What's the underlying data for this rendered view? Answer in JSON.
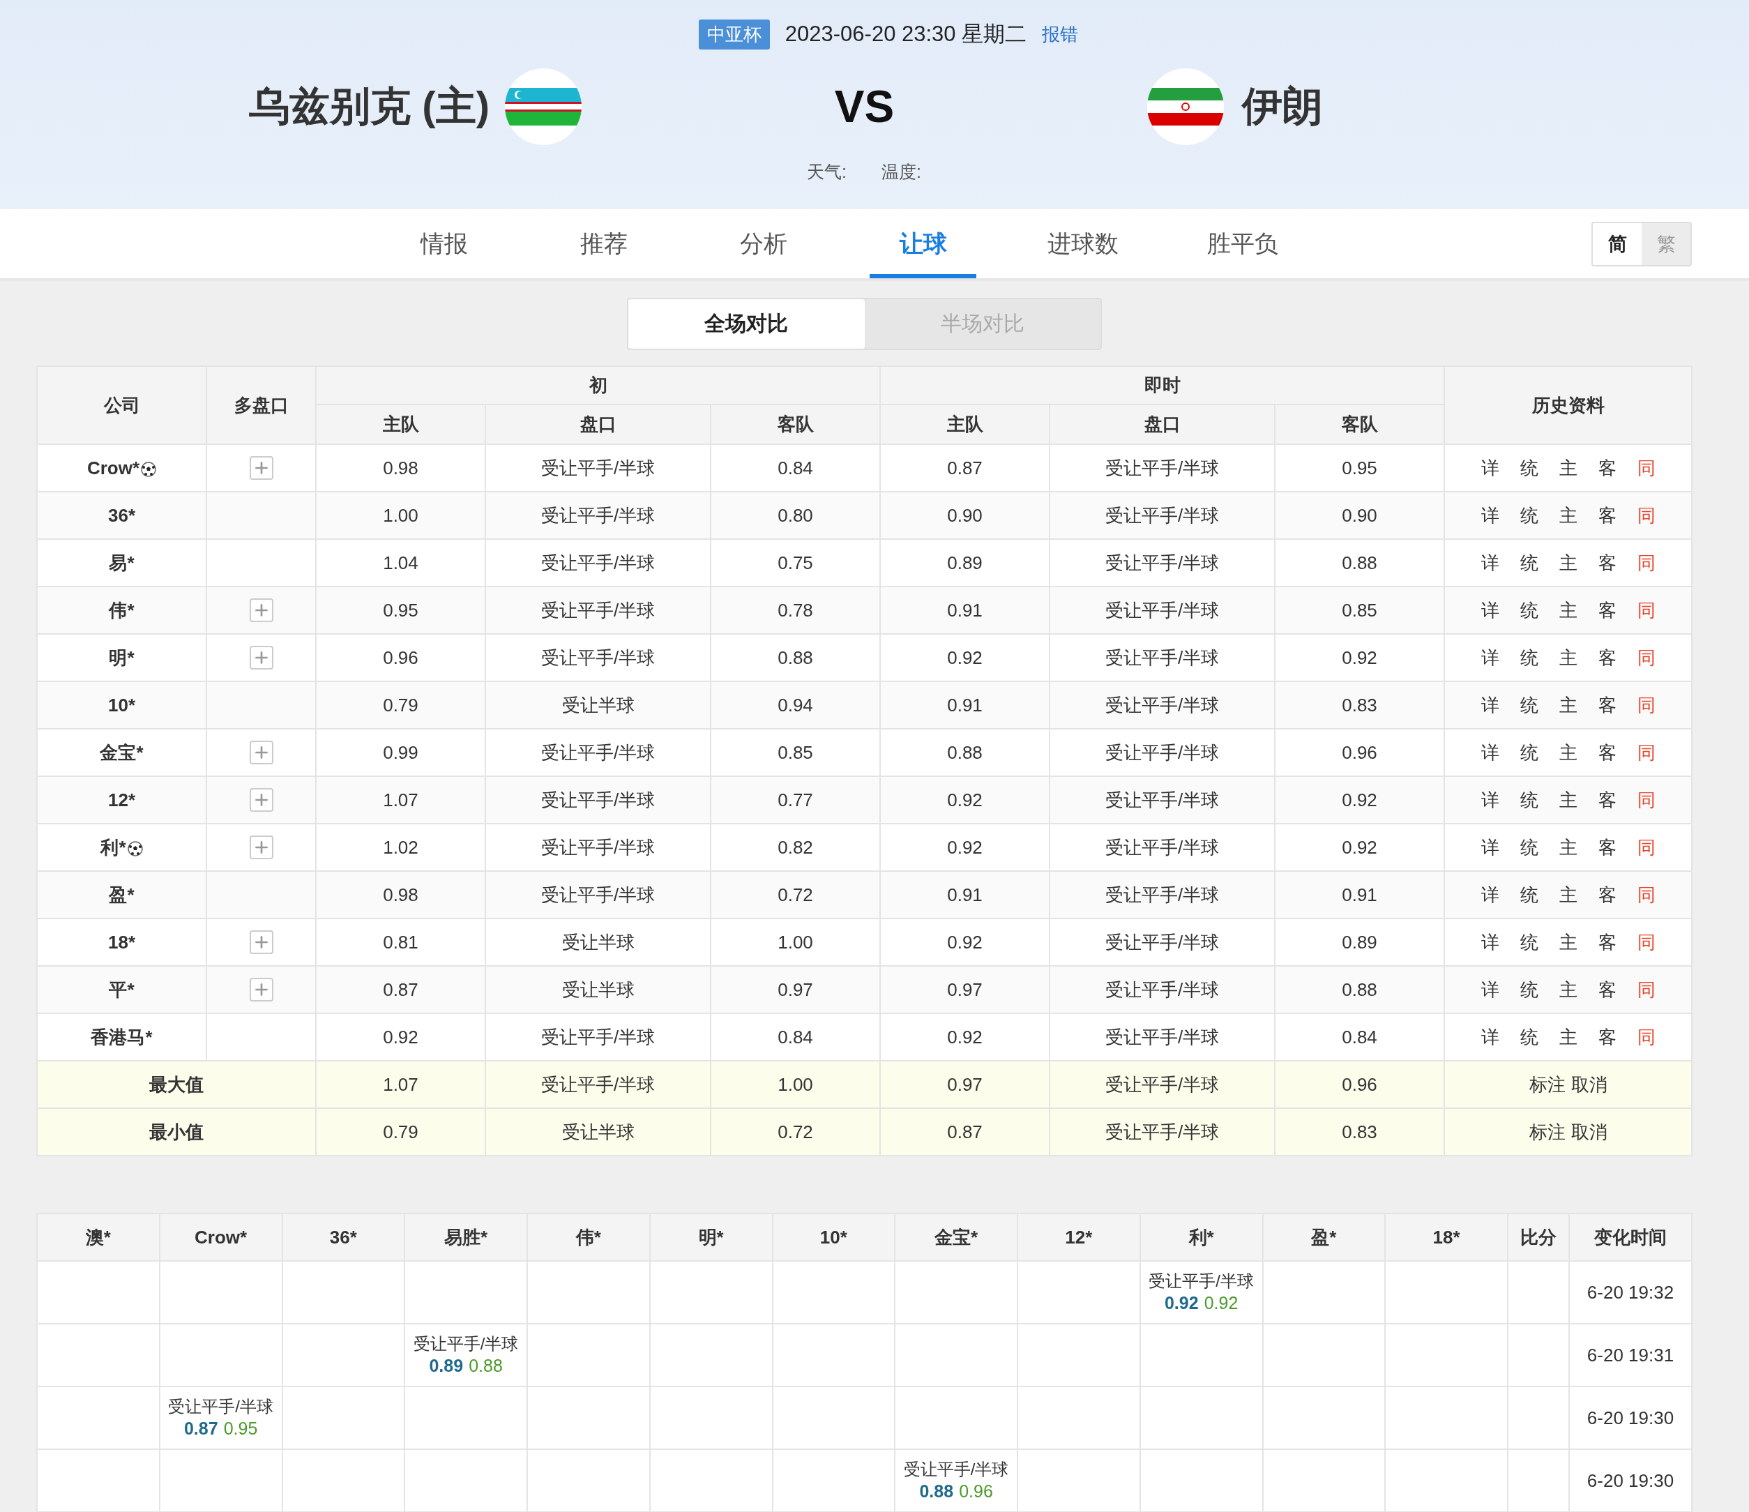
{
  "match": {
    "league": "中亚杯",
    "datetime": "2023-06-20 23:30 星期二",
    "report_link": "报错",
    "home": "乌兹别克 (主)",
    "vs": "VS",
    "away": "伊朗",
    "weather": "天气:",
    "temperature": "温度:"
  },
  "tabs": [
    {
      "label": "情报",
      "selected": false
    },
    {
      "label": "推荐",
      "selected": false
    },
    {
      "label": "分析",
      "selected": false
    },
    {
      "label": "让球",
      "selected": true
    },
    {
      "label": "进球数",
      "selected": false
    },
    {
      "label": "胜平负",
      "selected": false
    }
  ],
  "script_toggle": [
    {
      "label": "简",
      "selected": true
    },
    {
      "label": "繁",
      "selected": false
    }
  ],
  "compare_toggle": [
    {
      "label": "全场对比",
      "selected": true
    },
    {
      "label": "半场对比",
      "selected": false
    }
  ],
  "odds_table": {
    "columns": {
      "company": "公司",
      "multi": "多盘口",
      "groups": [
        {
          "label": "初",
          "sub": [
            "主队",
            "盘口",
            "客队"
          ]
        },
        {
          "label": "即时",
          "sub": [
            "主队",
            "盘口",
            "客队"
          ]
        }
      ],
      "history": "历史资料"
    },
    "rows": [
      {
        "company": "Crow*",
        "ball_icon": true,
        "expandable": true,
        "initial": [
          "0.98",
          "受让平手/半球",
          "0.84"
        ],
        "live": [
          "0.87",
          "受让平手/半球",
          "0.95"
        ],
        "links": [
          {
            "label": "详",
            "color": "#333333"
          },
          {
            "label": "统",
            "color": "#333333"
          },
          {
            "label": "主",
            "color": "#333333"
          },
          {
            "label": "客",
            "color": "#333333"
          },
          {
            "label": "同",
            "color": "#e8452c"
          }
        ]
      },
      {
        "company": "36*",
        "ball_icon": false,
        "expandable": false,
        "initial": [
          "1.00",
          "受让平手/半球",
          "0.80"
        ],
        "live": [
          "0.90",
          "受让平手/半球",
          "0.90"
        ],
        "links": [
          {
            "label": "详",
            "color": "#333333"
          },
          {
            "label": "统",
            "color": "#333333"
          },
          {
            "label": "主",
            "color": "#333333"
          },
          {
            "label": "客",
            "color": "#333333"
          },
          {
            "label": "同",
            "color": "#e8452c"
          }
        ]
      },
      {
        "company": "易*",
        "ball_icon": false,
        "expandable": false,
        "initial": [
          "1.04",
          "受让平手/半球",
          "0.75"
        ],
        "live": [
          "0.89",
          "受让平手/半球",
          "0.88"
        ],
        "links": [
          {
            "label": "详",
            "color": "#333333"
          },
          {
            "label": "统",
            "color": "#333333"
          },
          {
            "label": "主",
            "color": "#333333"
          },
          {
            "label": "客",
            "color": "#333333"
          },
          {
            "label": "同",
            "color": "#e8452c"
          }
        ]
      },
      {
        "company": "伟*",
        "ball_icon": false,
        "expandable": true,
        "initial": [
          "0.95",
          "受让平手/半球",
          "0.78"
        ],
        "live": [
          "0.91",
          "受让平手/半球",
          "0.85"
        ],
        "links": [
          {
            "label": "详",
            "color": "#333333"
          },
          {
            "label": "统",
            "color": "#333333"
          },
          {
            "label": "主",
            "color": "#333333"
          },
          {
            "label": "客",
            "color": "#333333"
          },
          {
            "label": "同",
            "color": "#e8452c"
          }
        ]
      },
      {
        "company": "明*",
        "ball_icon": false,
        "expandable": true,
        "initial": [
          "0.96",
          "受让平手/半球",
          "0.88"
        ],
        "live": [
          "0.92",
          "受让平手/半球",
          "0.92"
        ],
        "links": [
          {
            "label": "详",
            "color": "#333333"
          },
          {
            "label": "统",
            "color": "#333333"
          },
          {
            "label": "主",
            "color": "#333333"
          },
          {
            "label": "客",
            "color": "#333333"
          },
          {
            "label": "同",
            "color": "#e8452c"
          }
        ]
      },
      {
        "company": "10*",
        "ball_icon": false,
        "expandable": false,
        "initial": [
          "0.79",
          "受让半球",
          "0.94"
        ],
        "live": [
          "0.91",
          "受让平手/半球",
          "0.83"
        ],
        "links": [
          {
            "label": "详",
            "color": "#333333"
          },
          {
            "label": "统",
            "color": "#333333"
          },
          {
            "label": "主",
            "color": "#333333"
          },
          {
            "label": "客",
            "color": "#333333"
          },
          {
            "label": "同",
            "color": "#e8452c"
          }
        ]
      },
      {
        "company": "金宝*",
        "ball_icon": false,
        "expandable": true,
        "initial": [
          "0.99",
          "受让平手/半球",
          "0.85"
        ],
        "live": [
          "0.88",
          "受让平手/半球",
          "0.96"
        ],
        "links": [
          {
            "label": "详",
            "color": "#333333"
          },
          {
            "label": "统",
            "color": "#333333"
          },
          {
            "label": "主",
            "color": "#333333"
          },
          {
            "label": "客",
            "color": "#333333"
          },
          {
            "label": "同",
            "color": "#e8452c"
          }
        ]
      },
      {
        "company": "12*",
        "ball_icon": false,
        "expandable": true,
        "initial": [
          "1.07",
          "受让平手/半球",
          "0.77"
        ],
        "live": [
          "0.92",
          "受让平手/半球",
          "0.92"
        ],
        "links": [
          {
            "label": "详",
            "color": "#333333"
          },
          {
            "label": "统",
            "color": "#333333"
          },
          {
            "label": "主",
            "color": "#333333"
          },
          {
            "label": "客",
            "color": "#333333"
          },
          {
            "label": "同",
            "color": "#e8452c"
          }
        ]
      },
      {
        "company": "利*",
        "ball_icon": true,
        "expandable": true,
        "initial": [
          "1.02",
          "受让平手/半球",
          "0.82"
        ],
        "live": [
          "0.92",
          "受让平手/半球",
          "0.92"
        ],
        "links": [
          {
            "label": "详",
            "color": "#333333"
          },
          {
            "label": "统",
            "color": "#333333"
          },
          {
            "label": "主",
            "color": "#333333"
          },
          {
            "label": "客",
            "color": "#333333"
          },
          {
            "label": "同",
            "color": "#e8452c"
          }
        ]
      },
      {
        "company": "盈*",
        "ball_icon": false,
        "expandable": false,
        "initial": [
          "0.98",
          "受让平手/半球",
          "0.72"
        ],
        "live": [
          "0.91",
          "受让平手/半球",
          "0.91"
        ],
        "links": [
          {
            "label": "详",
            "color": "#333333"
          },
          {
            "label": "统",
            "color": "#333333"
          },
          {
            "label": "主",
            "color": "#333333"
          },
          {
            "label": "客",
            "color": "#333333"
          },
          {
            "label": "同",
            "color": "#e8452c"
          }
        ]
      },
      {
        "company": "18*",
        "ball_icon": false,
        "expandable": true,
        "initial": [
          "0.81",
          "受让半球",
          "1.00"
        ],
        "live": [
          "0.92",
          "受让平手/半球",
          "0.89"
        ],
        "links": [
          {
            "label": "详",
            "color": "#333333"
          },
          {
            "label": "统",
            "color": "#333333"
          },
          {
            "label": "主",
            "color": "#333333"
          },
          {
            "label": "客",
            "color": "#333333"
          },
          {
            "label": "同",
            "color": "#e8452c"
          }
        ]
      },
      {
        "company": "平*",
        "ball_icon": false,
        "expandable": true,
        "initial": [
          "0.87",
          "受让半球",
          "0.97"
        ],
        "live": [
          "0.97",
          "受让平手/半球",
          "0.88"
        ],
        "links": [
          {
            "label": "详",
            "color": "#333333"
          },
          {
            "label": "统",
            "color": "#333333"
          },
          {
            "label": "主",
            "color": "#333333"
          },
          {
            "label": "客",
            "color": "#333333"
          },
          {
            "label": "同",
            "color": "#e8452c"
          }
        ]
      },
      {
        "company": "香港马*",
        "ball_icon": false,
        "expandable": false,
        "initial": [
          "0.92",
          "受让平手/半球",
          "0.84"
        ],
        "live": [
          "0.92",
          "受让平手/半球",
          "0.84"
        ],
        "links": [
          {
            "label": "详",
            "color": "#333333"
          },
          {
            "label": "统",
            "color": "#333333"
          },
          {
            "label": "主",
            "color": "#333333"
          },
          {
            "label": "客",
            "color": "#333333"
          },
          {
            "label": "同",
            "color": "#e8452c"
          }
        ]
      }
    ],
    "summary": [
      {
        "label": "最大值",
        "initial": [
          "1.07",
          "受让平手/半球",
          "1.00"
        ],
        "live": [
          "0.97",
          "受让平手/半球",
          "0.96"
        ],
        "actions": [
          "标注",
          "取消"
        ]
      },
      {
        "label": "最小值",
        "initial": [
          "0.79",
          "受让半球",
          "0.72"
        ],
        "live": [
          "0.87",
          "受让平手/半球",
          "0.83"
        ],
        "actions": [
          "标注",
          "取消"
        ]
      }
    ]
  },
  "changes_table": {
    "columns": [
      "澳*",
      "Crow*",
      "36*",
      "易胜*",
      "伟*",
      "明*",
      "10*",
      "金宝*",
      "12*",
      "利*",
      "盈*",
      "18*",
      "比分",
      "变化时间"
    ],
    "rows": [
      {
        "cells": [
          null,
          null,
          null,
          null,
          null,
          null,
          null,
          null,
          null,
          {
            "line": "受让平手/半球",
            "home": "0.92",
            "away": "0.92"
          },
          null,
          null,
          null
        ],
        "time": "6-20 19:32"
      },
      {
        "cells": [
          null,
          null,
          null,
          {
            "line": "受让平手/半球",
            "home": "0.89",
            "away": "0.88"
          },
          null,
          null,
          null,
          null,
          null,
          null,
          null,
          null,
          null
        ],
        "time": "6-20 19:31"
      },
      {
        "cells": [
          null,
          {
            "line": "受让平手/半球",
            "home": "0.87",
            "away": "0.95"
          },
          null,
          null,
          null,
          null,
          null,
          null,
          null,
          null,
          null,
          null,
          null
        ],
        "time": "6-20 19:30"
      },
      {
        "cells": [
          null,
          null,
          null,
          null,
          null,
          null,
          null,
          {
            "line": "受让平手/半球",
            "home": "0.88",
            "away": "0.96"
          },
          null,
          null,
          null,
          null,
          null
        ],
        "time": "6-20 19:30"
      }
    ]
  }
}
